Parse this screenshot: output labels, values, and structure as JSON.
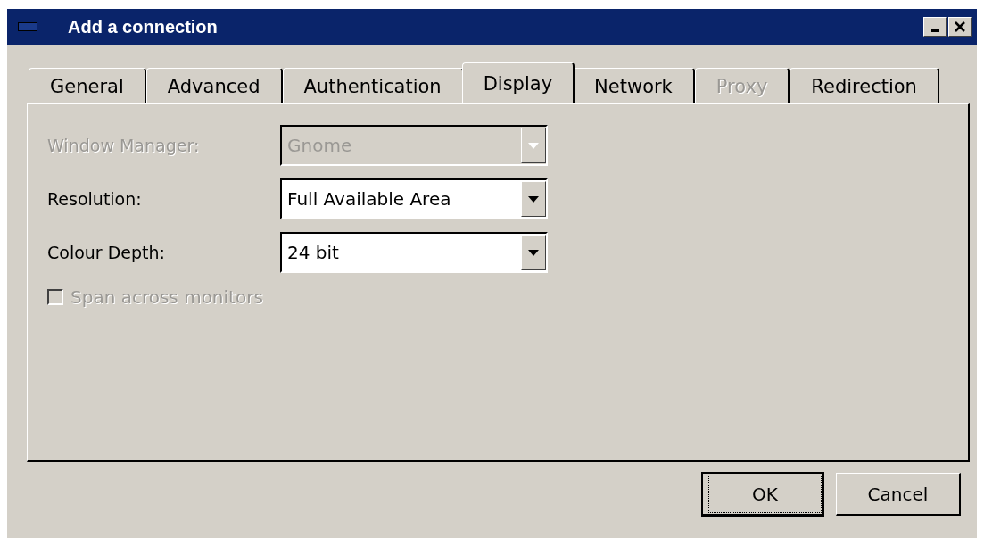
{
  "window": {
    "title": "Add a connection"
  },
  "tabs": [
    {
      "label": "General",
      "selected": false,
      "disabled": false
    },
    {
      "label": "Advanced",
      "selected": false,
      "disabled": false
    },
    {
      "label": "Authentication",
      "selected": false,
      "disabled": false
    },
    {
      "label": "Display",
      "selected": true,
      "disabled": false
    },
    {
      "label": "Network",
      "selected": false,
      "disabled": false
    },
    {
      "label": "Proxy",
      "selected": false,
      "disabled": true
    },
    {
      "label": "Redirection",
      "selected": false,
      "disabled": false
    }
  ],
  "fields": [
    {
      "label": "Window Manager:",
      "value": "Gnome",
      "disabled": true
    },
    {
      "label": "Resolution:",
      "value": "Full Available Area",
      "disabled": false
    },
    {
      "label": "Colour Depth:",
      "value": "24 bit",
      "disabled": false
    }
  ],
  "checkbox": {
    "label": "Span across monitors",
    "checked": false,
    "disabled": true
  },
  "buttons": [
    {
      "label": "OK",
      "default": true
    },
    {
      "label": "Cancel",
      "default": false
    }
  ]
}
